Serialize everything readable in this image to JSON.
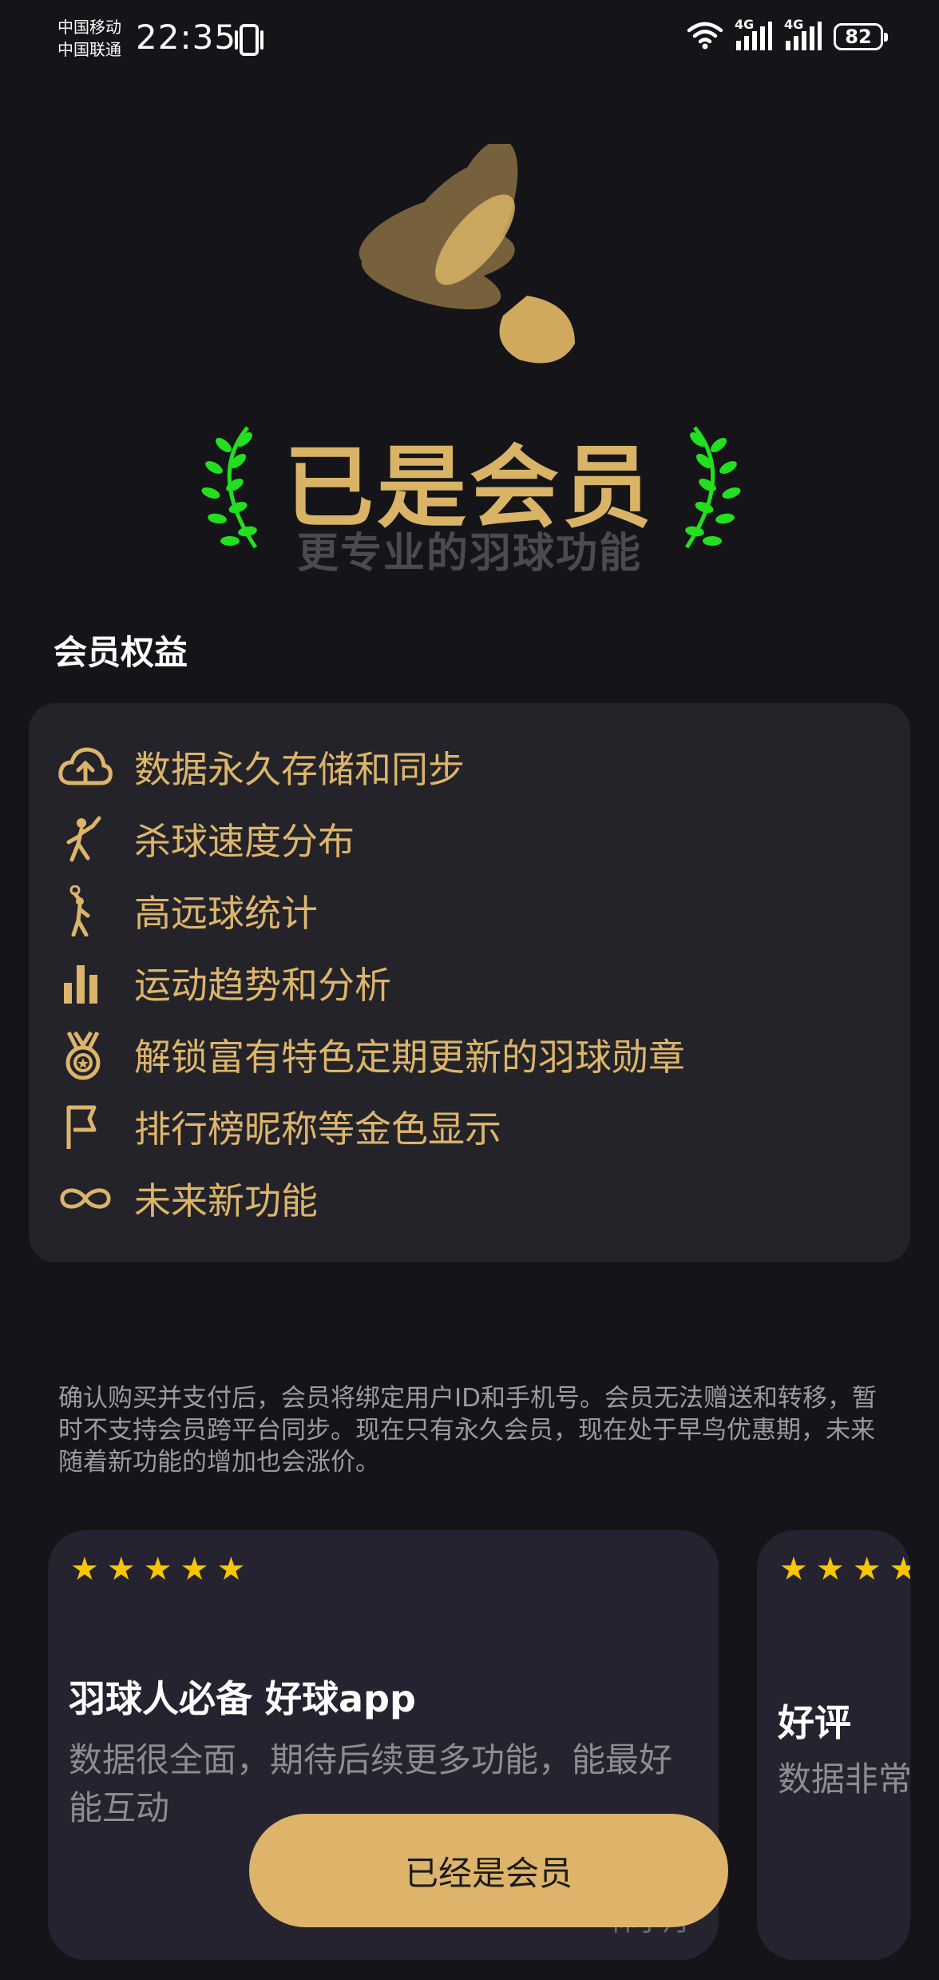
{
  "status_bar": {
    "carrier_1": "中国移动",
    "carrier_2": "中国联通",
    "time": "22:35",
    "network_1": "4G",
    "network_2": "4G",
    "battery": "82",
    "icons": [
      "vibrate-icon",
      "wifi-icon",
      "signal-icon",
      "battery-icon"
    ]
  },
  "hero": {
    "title": "已是会员",
    "subtitle": "更专业的羽球功能",
    "logo_icon": "shuttlecock-icon",
    "laurel_icon": "laurel-icon"
  },
  "benefits_section": {
    "title": "会员权益",
    "items": [
      {
        "icon": "cloud-upload-icon",
        "label": "数据永久存储和同步"
      },
      {
        "icon": "smash-player-icon",
        "label": "杀球速度分布"
      },
      {
        "icon": "clear-player-icon",
        "label": "高远球统计"
      },
      {
        "icon": "bar-chart-icon",
        "label": "运动趋势和分析"
      },
      {
        "icon": "medal-icon",
        "label": "解锁富有特色定期更新的羽球勋章"
      },
      {
        "icon": "flag-icon",
        "label": "排行榜昵称等金色显示"
      },
      {
        "icon": "infinity-icon",
        "label": "未来新功能"
      }
    ]
  },
  "notice": "确认购买并支付后，会员将绑定用户ID和手机号。会员无法赠送和转移，暂时不支持会员跨平台同步。现在只有永久会员，现在处于早鸟优惠期，未来随着新功能的增加也会涨价。",
  "reviews": [
    {
      "stars": 5,
      "title": "羽球人必备 好球app",
      "body": "数据很全面，期待后续更多功能，能最好能互动",
      "author": "林小月"
    },
    {
      "stars": 5,
      "title": "好评",
      "body": "数据非常"
    }
  ],
  "action_button": {
    "label": "已经是会员"
  },
  "colors": {
    "background": "#151519",
    "card": "#232329",
    "gold": "#dcb56a",
    "laurel": "#22e01f",
    "star": "#f7c600"
  }
}
